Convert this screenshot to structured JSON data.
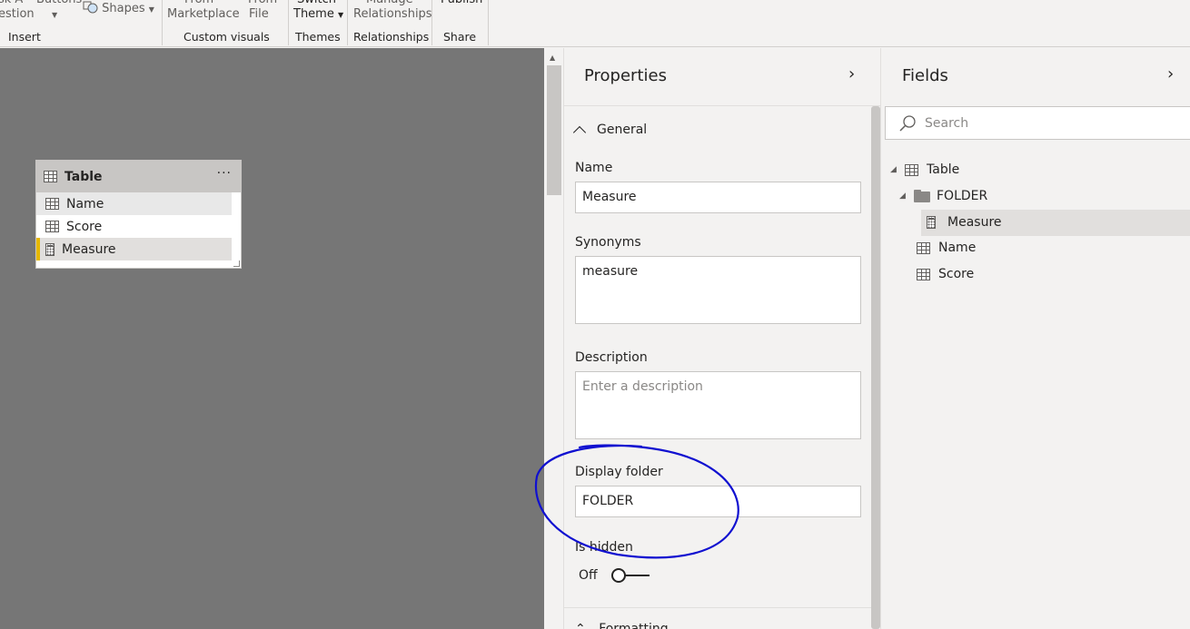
{
  "ribbon": {
    "partial_top": [
      "sk A",
      "Buttons",
      "Shapes",
      "From",
      "From",
      "Switch",
      "Manage",
      "Publish"
    ],
    "insert_items": [
      "estion",
      "Shapes"
    ],
    "custom_visuals_items": [
      "Marketplace",
      "File"
    ],
    "themes_item": "Theme",
    "relationships_item": "Relationships",
    "groups": [
      "Insert",
      "Custom visuals",
      "Themes",
      "Relationships",
      "Share"
    ]
  },
  "canvas": {
    "table_card": {
      "title": "Table",
      "menu": "···",
      "rows": [
        "Name",
        "Score",
        "Measure"
      ]
    }
  },
  "properties": {
    "title": "Properties",
    "section": "General",
    "name_label": "Name",
    "name_value": "Measure",
    "synonyms_label": "Synonyms",
    "synonyms_value": "measure",
    "description_label": "Description",
    "description_placeholder": "Enter a description",
    "display_folder_label": "Display folder",
    "display_folder_value": "FOLDER",
    "is_hidden_label": "Is hidden",
    "is_hidden_state": "Off",
    "next_section_partial": "Formatting"
  },
  "fields": {
    "title": "Fields",
    "search_placeholder": "Search",
    "tree": {
      "table": "Table",
      "folder": "FOLDER",
      "measure": "Measure",
      "name": "Name",
      "score": "Score"
    }
  },
  "colors": {
    "canvas": "#767676",
    "pane": "#f3f2f1",
    "accent_yellow": "#e6b800",
    "annotation": "#1010d0"
  }
}
